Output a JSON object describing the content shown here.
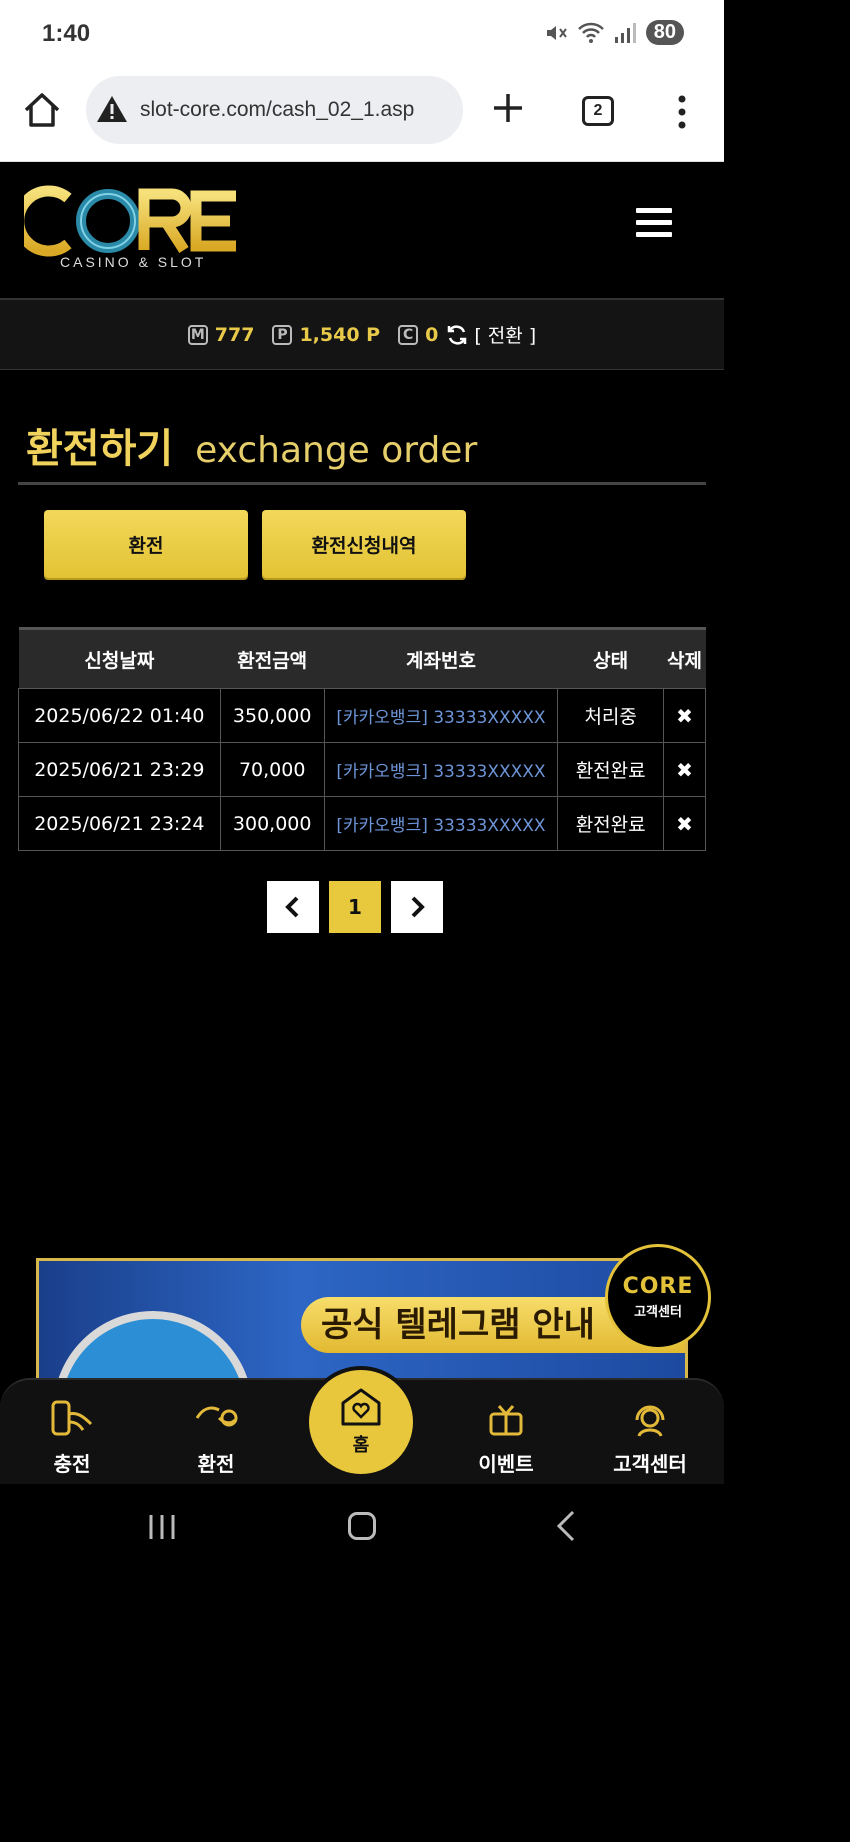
{
  "status": {
    "time": "1:40",
    "battery": "80"
  },
  "browser": {
    "url": "slot-core.com/cash_02_1.asp",
    "tab_count": "2"
  },
  "site": {
    "logo": "CORE",
    "logo_sub": "CASINO & SLOT"
  },
  "balance": {
    "m_badge": "M",
    "m_value": "777",
    "p_badge": "P",
    "p_value": "1,540 P",
    "c_badge": "C",
    "c_value": "0",
    "convert_label": "[ 전환 ]"
  },
  "page": {
    "title_ko": "환전하기",
    "title_en": "exchange order",
    "btn_exchange": "환전",
    "btn_history": "환전신청내역"
  },
  "table": {
    "headers": [
      "신청날짜",
      "환전금액",
      "계좌번호",
      "상태",
      "삭제"
    ],
    "rows": [
      {
        "date": "2025/06/22 01:40",
        "amount": "350,000",
        "account": "[카카오뱅크] 33333XXXXX",
        "status": "처리중",
        "delete": "✖"
      },
      {
        "date": "2025/06/21 23:29",
        "amount": "70,000",
        "account": "[카카오뱅크] 33333XXXXX",
        "status": "환전완료",
        "delete": "✖"
      },
      {
        "date": "2025/06/21 23:24",
        "amount": "300,000",
        "account": "[카카오뱅크] 33333XXXXX",
        "status": "환전완료",
        "delete": "✖"
      }
    ]
  },
  "pagination": {
    "prev": "‹",
    "current": "1",
    "next": "›"
  },
  "banner": {
    "text": "공식 텔레그램 안내"
  },
  "cs_float": {
    "logo": "CORE",
    "label": "고객센터"
  },
  "bottom_nav": {
    "charge": "충전",
    "exchange": "환전",
    "home": "홈",
    "event": "이벤트",
    "cs": "고객센터"
  },
  "colors": {
    "accent": "#e8c83c",
    "link": "#6d95d8",
    "background": "#000000"
  }
}
